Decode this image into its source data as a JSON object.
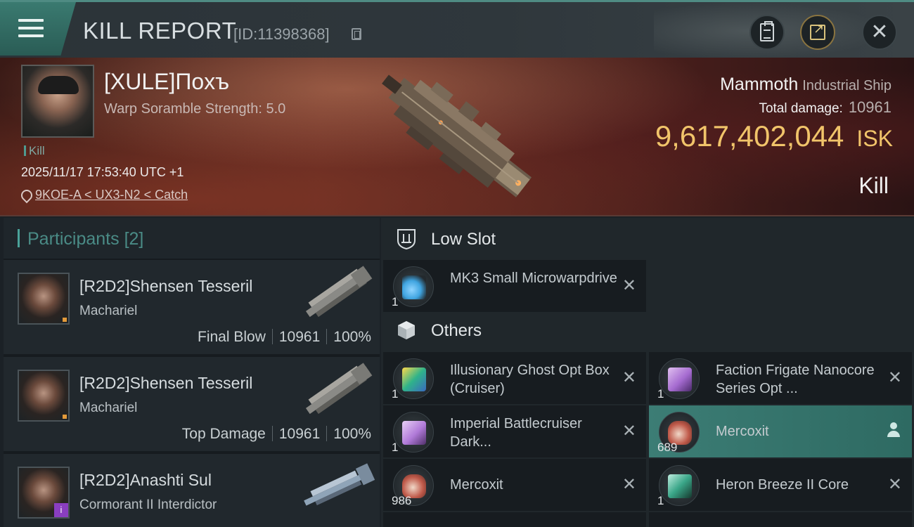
{
  "header": {
    "title": "KILL REPORT",
    "report_id": "[ID:11398368]"
  },
  "victim": {
    "name": "[XULE]Поxъ",
    "attribute": "Warp Soramble Strength: 5.0",
    "tag": "Kill",
    "timestamp": "2025/11/17 17:53:40 UTC +1",
    "location": "9KOE-A < UX3-N2 < Catch"
  },
  "ship": {
    "name": "Mammoth",
    "class": "Industrial Ship",
    "total_damage_label": "Total damage:",
    "total_damage": "10961",
    "value": "9,617,402,044",
    "currency": "ISK",
    "result": "Kill"
  },
  "participants": {
    "title": "Participants",
    "count": "[2]",
    "rows": [
      {
        "name": "[R2D2]Shensen Tesseril",
        "ship": "Machariel",
        "role": "Final Blow",
        "damage": "10961",
        "percent": "100%"
      },
      {
        "name": "[R2D2]Shensen Tesseril",
        "ship": "Machariel",
        "role": "Top Damage",
        "damage": "10961",
        "percent": "100%"
      },
      {
        "name": "[R2D2]Anashti Sul",
        "ship": "Cormorant II Interdictor"
      }
    ]
  },
  "sections": {
    "low_slot": "Low Slot",
    "others": "Others"
  },
  "items": [
    {
      "name": "MK3 Small Microwarpdrive",
      "qty": "1",
      "icon": "microwarpdrive-icon",
      "color": "#3fa4e0"
    },
    {
      "name": "Illusionary Ghost Opt Box (Cruiser)",
      "qty": "1",
      "icon": "ghost-box-icon",
      "color": "#2fb38a"
    },
    {
      "name": "Faction Frigate Nanocore Series Opt ...",
      "qty": "1",
      "icon": "nanocore-box-icon",
      "color": "#a56bd0"
    },
    {
      "name": "Imperial Battlecruiser Dark...",
      "qty": "1",
      "icon": "imperial-box-icon",
      "color": "#b07ad8"
    },
    {
      "name": "Mercoxit",
      "qty": "689",
      "icon": "mercoxit-icon",
      "color": "#c05a4a"
    },
    {
      "name": "Mercoxit",
      "qty": "986",
      "icon": "mercoxit-icon",
      "color": "#c05a4a"
    },
    {
      "name": "Heron Breeze II Core",
      "qty": "1",
      "icon": "core-icon",
      "color": "#3aa688"
    }
  ],
  "colors": {
    "accent": "#4aa39a",
    "isk": "#f1c46a",
    "highlight": "#3c7d75"
  }
}
